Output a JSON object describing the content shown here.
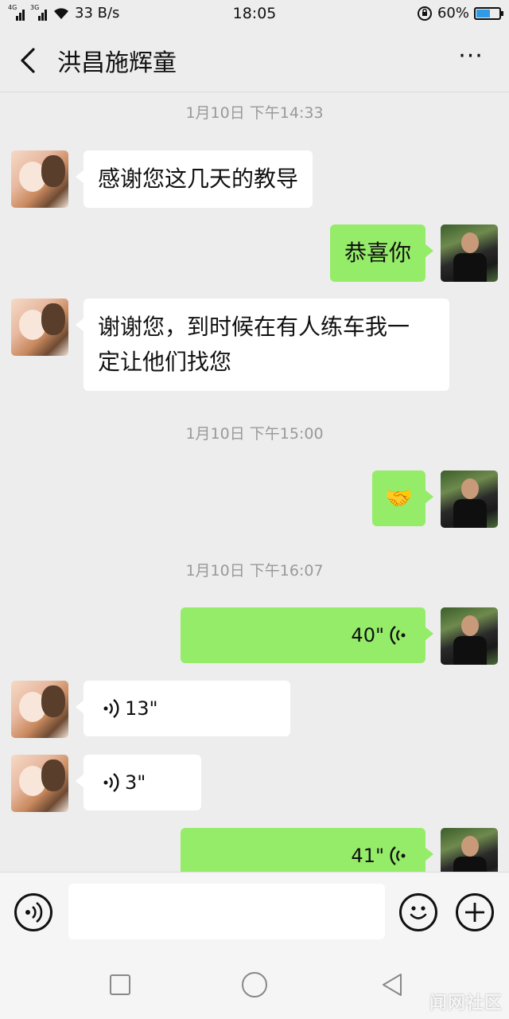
{
  "status_bar": {
    "net1": "4G",
    "net2": "3G",
    "speed": "33 B/s",
    "time": "18:05",
    "battery_text": "60%",
    "battery_level": 0.6,
    "battery_color": "#2f9be6"
  },
  "header": {
    "title": "洪昌施辉童",
    "more": "···",
    "back_icon": "chevron-left-icon"
  },
  "messages": [
    {
      "type": "timestamp",
      "text": "1月10日 下午14:33"
    },
    {
      "type": "text",
      "from": "them",
      "text": "感谢您这几天的教导"
    },
    {
      "type": "text",
      "from": "me",
      "text": "恭喜你"
    },
    {
      "type": "text",
      "from": "them",
      "line1": "谢谢您，到时候在有人练车我一",
      "line2": "定让他们找您"
    },
    {
      "type": "timestamp",
      "text": "1月10日 下午15:00"
    },
    {
      "type": "emoji",
      "from": "me",
      "text": "🤝"
    },
    {
      "type": "timestamp",
      "text": "1月10日 下午16:07"
    },
    {
      "type": "voice",
      "from": "me",
      "text": "40\""
    },
    {
      "type": "voice",
      "from": "them",
      "text": "13\""
    },
    {
      "type": "voice",
      "from": "them",
      "text": "3\""
    },
    {
      "type": "voice",
      "from": "me",
      "text": "41\""
    }
  ],
  "input_bar": {
    "voice_icon": "voice-icon",
    "emoji_icon": "emoji-icon",
    "plus_icon": "plus-icon",
    "placeholder": ""
  },
  "colors": {
    "outgoing_bubble": "#95ec69",
    "incoming_bubble": "#ffffff",
    "background": "#ededed"
  },
  "watermark": "闻网社区"
}
